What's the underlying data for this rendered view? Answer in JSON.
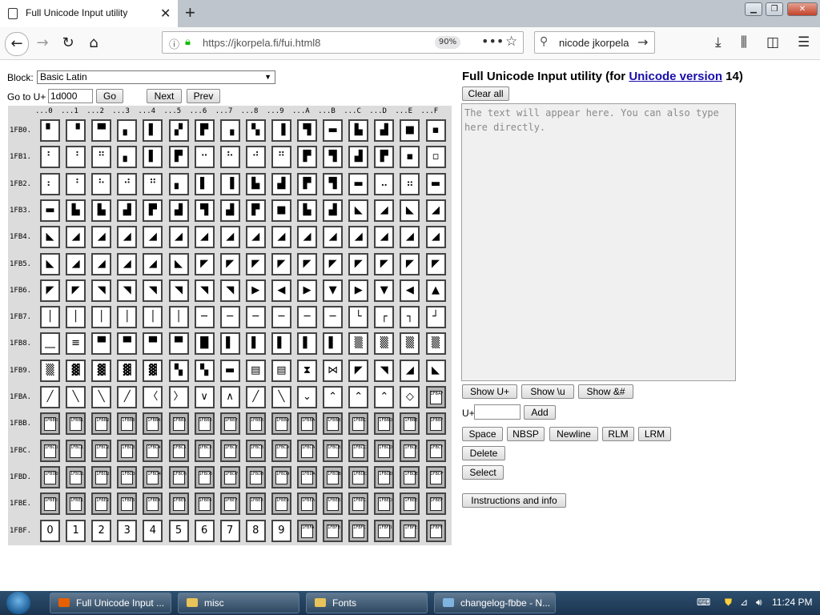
{
  "browser": {
    "tab_title": "Full Unicode Input utility",
    "tab_close": "✕",
    "new_tab": "+",
    "url": "https://jkorpela.fi/fui.html8",
    "zoom": "90%",
    "search_text": "nicode jkorpela",
    "window_min": "▁",
    "window_max": "❐",
    "window_close": "✕"
  },
  "controls": {
    "block_label": "Block:",
    "block_value": "Basic Latin",
    "goto_label": "Go to U+",
    "goto_value": "1d000",
    "go_button": "Go",
    "next_button": "Next",
    "prev_button": "Prev"
  },
  "grid": {
    "column_headers": [
      "...0",
      "...1",
      "...2",
      "...3",
      "...4",
      "...5",
      "...6",
      "...7",
      "...8",
      "...9",
      "...A",
      "...B",
      "...C",
      "...D",
      "...E",
      "...F"
    ],
    "row_headers": [
      "1FB0.",
      "1FB1.",
      "1FB2.",
      "1FB3.",
      "1FB4.",
      "1FB5.",
      "1FB6.",
      "1FB7.",
      "1FB8.",
      "1FB9.",
      "1FBA.",
      "1FBB.",
      "1FBC.",
      "1FBD.",
      "1FBE.",
      "1FBF."
    ],
    "rows": [
      [
        "▘",
        "▝",
        "▀",
        "▖",
        "▌",
        "▞",
        "▛",
        "▗",
        "▚",
        "▐",
        "▜",
        "▬",
        "▙",
        "▟",
        "■",
        "▪"
      ],
      [
        "⠃",
        "⠘",
        "⠛",
        "▖",
        "▌",
        "▛",
        "⠒",
        "⠓",
        "⠚",
        "⠛",
        "▛",
        "▜",
        "▟",
        "▛",
        "▪",
        "▫"
      ],
      [
        "⠆",
        "⠘",
        "⠓",
        "⠚",
        "⠛",
        "▖",
        "▌",
        "▐",
        "▙",
        "▟",
        "▛",
        "▜",
        "▬",
        "⠤",
        "⠶",
        "▬"
      ],
      [
        "▬",
        "▙",
        "▙",
        "▟",
        "▛",
        "▟",
        "▜",
        "▟",
        "▛",
        "■",
        "▙",
        "▟",
        "◣",
        "◢",
        "◣",
        "◢"
      ],
      [
        "◣",
        "◢",
        "◢",
        "◢",
        "◢",
        "◢",
        "◢",
        "◢",
        "◢",
        "◢",
        "◢",
        "◢",
        "◢",
        "◢",
        "◢",
        "◢"
      ],
      [
        "◣",
        "◢",
        "◢",
        "◢",
        "◢",
        "◣",
        "◤",
        "◤",
        "◤",
        "◤",
        "◤",
        "◤",
        "◤",
        "◤",
        "◤",
        "◤"
      ],
      [
        "◤",
        "◤",
        "◥",
        "◥",
        "◥",
        "◥",
        "◥",
        "◥",
        "▶",
        "◀",
        "▶",
        "▼",
        "▶",
        "▼",
        "◀",
        "▲"
      ],
      [
        "│",
        "│",
        "│",
        "│",
        "│",
        "│",
        "─",
        "─",
        "─",
        "─",
        "─",
        "─",
        "└",
        "┌",
        "┐",
        "┘"
      ],
      [
        "⎽",
        "≡",
        "▀",
        "▀",
        "▀",
        "▀",
        "█",
        "▌",
        "▌",
        "▌",
        "▌",
        "▌",
        "▒",
        "▒",
        "▒",
        "▒"
      ],
      [
        "▒",
        "▓",
        "▓",
        "▓",
        "▓",
        "▚",
        "▚",
        "▬",
        "▤",
        "▤",
        "⧗",
        "⋈",
        "◤",
        "◥",
        "◢",
        "◣"
      ],
      [
        "╱",
        "╲",
        "╲",
        "╱",
        "〈",
        "〉",
        "∨",
        "∧",
        "╱",
        "╲",
        "⌄",
        "⌃",
        "⌃",
        "⌃",
        "◇",
        "1FBAF"
      ],
      [
        "1FBB0",
        "1FBB1",
        "1FBB2",
        "1FBB3",
        "1FBB4",
        "1FBB5",
        "1FBB6",
        "1FBB7",
        "1FBB8",
        "1FBB9",
        "1FBBA",
        "1FBBB",
        "1FBBC",
        "1FBBD",
        "1FBBE",
        "1FBBF"
      ],
      [
        "1FBC0",
        "1FBC1",
        "1FBC2",
        "1FBC3",
        "1FBC4",
        "1FBC5",
        "1FBC6",
        "1FBC7",
        "1FBC8",
        "1FBC9",
        "1FBCA",
        "1FBCB",
        "1FBCC",
        "1FBCD",
        "1FBCE",
        "1FBCF"
      ],
      [
        "1FBD0",
        "1FBD1",
        "1FBD2",
        "1FBD3",
        "1FBD4",
        "1FBD5",
        "1FBD6",
        "1FBD7",
        "1FBD8",
        "1FBD9",
        "1FBDA",
        "1FBDB",
        "1FBDC",
        "1FBDD",
        "1FBDE",
        "1FBDF"
      ],
      [
        "1FBE0",
        "1FBE1",
        "1FBE2",
        "1FBE3",
        "1FBE4",
        "1FBE5",
        "1FBE6",
        "1FBE7",
        "1FBE8",
        "1FBE9",
        "1FBEA",
        "1FBEB",
        "1FBEC",
        "1FBED",
        "1FBEE",
        "1FBEF"
      ],
      [
        "0",
        "1",
        "2",
        "3",
        "4",
        "5",
        "6",
        "7",
        "8",
        "9",
        "1FBFA",
        "1FBFB",
        "1FBFC",
        "1FBFD",
        "1FBFE",
        "1FBFF"
      ]
    ]
  },
  "panel": {
    "title_prefix": "Full Unicode Input utility (for ",
    "title_link": "Unicode version",
    "title_suffix": " 14)",
    "clear_button": "Clear all",
    "textarea_placeholder": "The text will appear here. You can also type here directly.",
    "show_uplus": "Show U+",
    "show_u": "Show \\u",
    "show_amp": "Show &#",
    "uplus_label": "U+",
    "add_button": "Add",
    "space_button": "Space",
    "nbsp_button": "NBSP",
    "newline_button": "Newline",
    "rlm_button": "RLM",
    "lrm_button": "LRM",
    "delete_button": "Delete",
    "select_button": "Select",
    "instructions_button": "Instructions and info"
  },
  "taskbar": {
    "items": [
      {
        "label": "Full Unicode Input ...",
        "icon": "firefox-icon"
      },
      {
        "label": "misc",
        "icon": "folder-icon"
      },
      {
        "label": "Fonts",
        "icon": "folder-icon"
      },
      {
        "label": "changelog-fbbe - N...",
        "icon": "notepad-icon"
      }
    ],
    "clock": "11:24 PM"
  },
  "colors": {
    "link": "#1a0dab",
    "grid_bg": "#dcdcdc",
    "placeholder_cell": "#b6b6b6"
  }
}
